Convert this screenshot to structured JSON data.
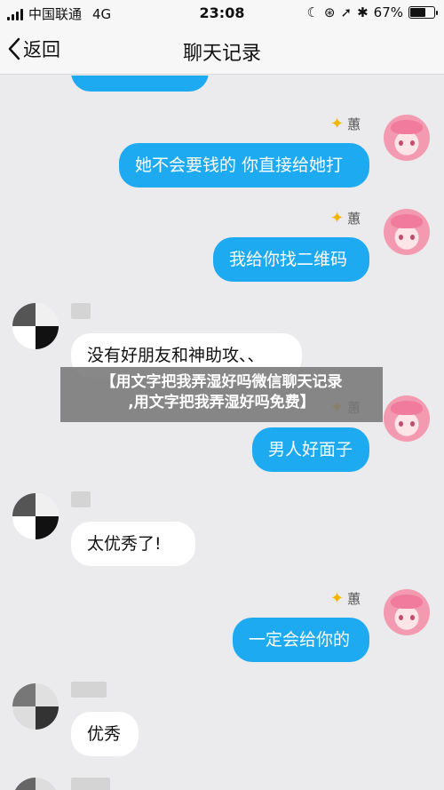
{
  "status_bar": {
    "carrier": "中国联通",
    "network": "4G",
    "time": "23:08",
    "battery": "67%",
    "battery_level": 0.67
  },
  "nav": {
    "back_label": "返回",
    "title": "聊天记录"
  },
  "messages": [
    {
      "side": "in",
      "text": ""
    },
    {
      "side": "out",
      "sender": "蕙",
      "text": "她不会要钱的 你直接给她打"
    },
    {
      "side": "out",
      "sender": "蕙",
      "text": "我给你找二维码"
    },
    {
      "side": "in",
      "text": "没有好朋友和神助攻、、"
    },
    {
      "side": "out",
      "sender": "蕙",
      "text": "男人好面子"
    },
    {
      "side": "in",
      "text": "太优秀了!"
    },
    {
      "side": "out",
      "sender": "蕙",
      "text": "一定会给你的"
    },
    {
      "side": "in",
      "text": "优秀"
    }
  ],
  "banner": {
    "line1": "【用文字把我弄湿好吗微信聊天记录",
    "line2": ",用文字把我弄湿好吗免费】"
  },
  "colors": {
    "outgoing_bubble": "#1eaaf1",
    "incoming_bubble": "#ffffff",
    "background": "#ebebed",
    "star": "#f2b600"
  }
}
